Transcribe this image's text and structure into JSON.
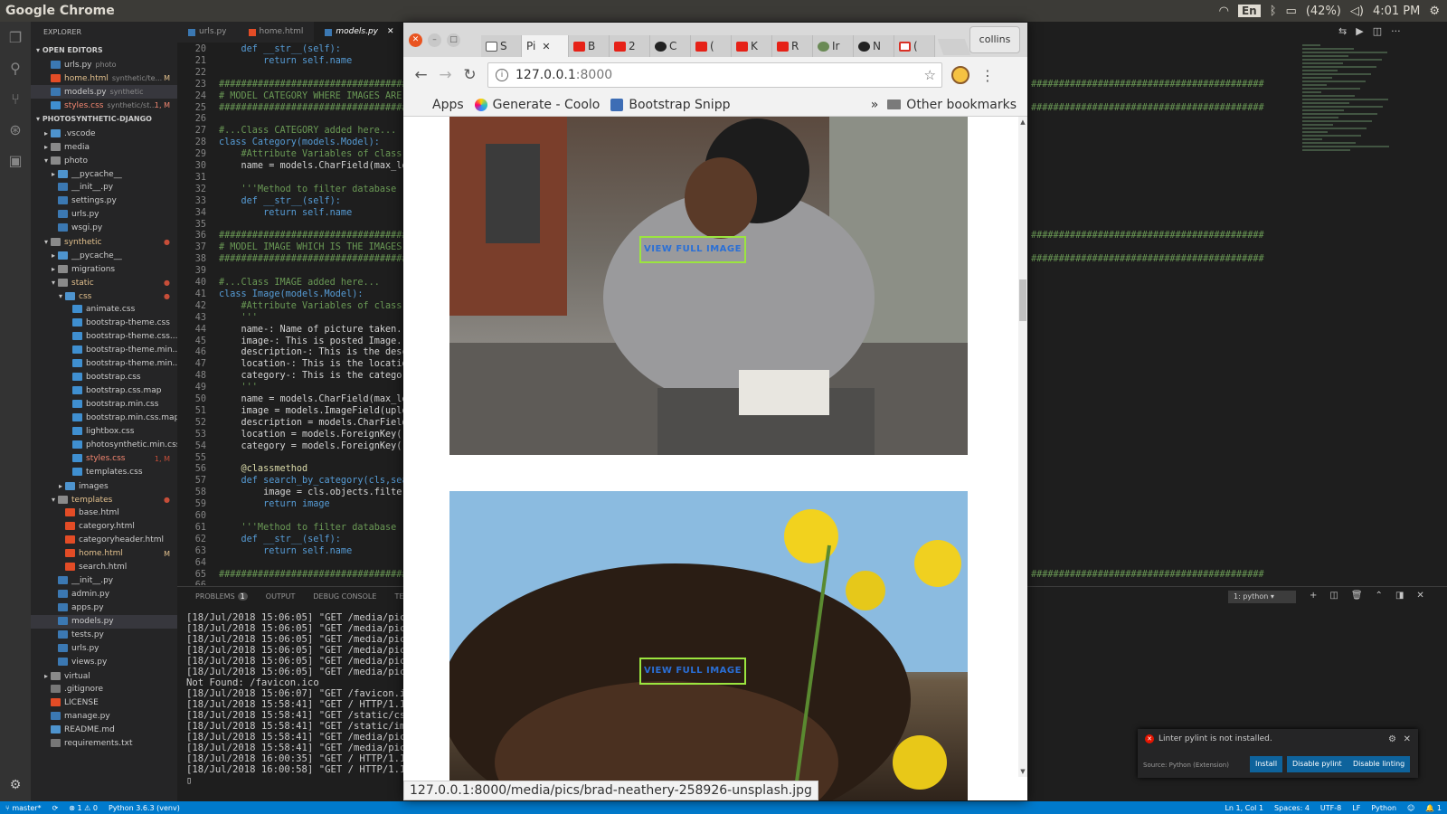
{
  "topbar": {
    "app_name": "Google Chrome",
    "lang": "En",
    "battery": "(42%)",
    "time": "4:01 PM"
  },
  "vscode": {
    "explorer_title": "EXPLORER",
    "open_editors_title": "OPEN EDITORS",
    "open_editors": [
      {
        "name": "urls.py",
        "sub": "photo",
        "badge": "",
        "type": "py"
      },
      {
        "name": "home.html",
        "sub": "synthetic/te...",
        "badge": "M",
        "type": "html"
      },
      {
        "name": "models.py",
        "sub": "synthetic",
        "badge": "",
        "type": "py"
      },
      {
        "name": "styles.css",
        "sub": "synthetic/st...",
        "badge": "1, M",
        "type": "css"
      }
    ],
    "project_title": "PHOTOSYNTHETIC-DJANGO",
    "tree": [
      {
        "name": ".vscode",
        "indent": 1,
        "type": "dirblue",
        "glyph": "▸",
        "badge": ""
      },
      {
        "name": "media",
        "indent": 1,
        "type": "dir",
        "glyph": "▸",
        "badge": ""
      },
      {
        "name": "photo",
        "indent": 1,
        "type": "dir",
        "glyph": "▾",
        "badge": ""
      },
      {
        "name": "__pycache__",
        "indent": 2,
        "type": "dirblue",
        "glyph": "▸",
        "badge": ""
      },
      {
        "name": "__init__.py",
        "indent": 2,
        "type": "py",
        "glyph": "",
        "badge": ""
      },
      {
        "name": "settings.py",
        "indent": 2,
        "type": "py",
        "glyph": "",
        "badge": ""
      },
      {
        "name": "urls.py",
        "indent": 2,
        "type": "py",
        "glyph": "",
        "badge": ""
      },
      {
        "name": "wsgi.py",
        "indent": 2,
        "type": "py",
        "glyph": "",
        "badge": ""
      },
      {
        "name": "synthetic",
        "indent": 1,
        "type": "dir",
        "glyph": "▾",
        "badge": "●"
      },
      {
        "name": "__pycache__",
        "indent": 2,
        "type": "dirblue",
        "glyph": "▸",
        "badge": ""
      },
      {
        "name": "migrations",
        "indent": 2,
        "type": "dir",
        "glyph": "▸",
        "badge": ""
      },
      {
        "name": "static",
        "indent": 2,
        "type": "dir",
        "glyph": "▾",
        "badge": "●"
      },
      {
        "name": "css",
        "indent": 3,
        "type": "dirblue",
        "glyph": "▾",
        "badge": "●"
      },
      {
        "name": "animate.css",
        "indent": 4,
        "type": "css",
        "glyph": "",
        "badge": ""
      },
      {
        "name": "bootstrap-theme.css",
        "indent": 4,
        "type": "css",
        "glyph": "",
        "badge": ""
      },
      {
        "name": "bootstrap-theme.css....",
        "indent": 4,
        "type": "css",
        "glyph": "",
        "badge": ""
      },
      {
        "name": "bootstrap-theme.min....",
        "indent": 4,
        "type": "css",
        "glyph": "",
        "badge": ""
      },
      {
        "name": "bootstrap-theme.min....",
        "indent": 4,
        "type": "css",
        "glyph": "",
        "badge": ""
      },
      {
        "name": "bootstrap.css",
        "indent": 4,
        "type": "css",
        "glyph": "",
        "badge": ""
      },
      {
        "name": "bootstrap.css.map",
        "indent": 4,
        "type": "css",
        "glyph": "",
        "badge": ""
      },
      {
        "name": "bootstrap.min.css",
        "indent": 4,
        "type": "css",
        "glyph": "",
        "badge": ""
      },
      {
        "name": "bootstrap.min.css.map",
        "indent": 4,
        "type": "css",
        "glyph": "",
        "badge": ""
      },
      {
        "name": "lightbox.css",
        "indent": 4,
        "type": "css",
        "glyph": "",
        "badge": ""
      },
      {
        "name": "photosynthetic.min.css",
        "indent": 4,
        "type": "css",
        "glyph": "",
        "badge": ""
      },
      {
        "name": "styles.css",
        "indent": 4,
        "type": "css",
        "glyph": "",
        "badge": "1, M"
      },
      {
        "name": "templates.css",
        "indent": 4,
        "type": "css",
        "glyph": "",
        "badge": ""
      },
      {
        "name": "images",
        "indent": 3,
        "type": "dirblue",
        "glyph": "▸",
        "badge": ""
      },
      {
        "name": "templates",
        "indent": 2,
        "type": "dir",
        "glyph": "▾",
        "badge": "●"
      },
      {
        "name": "base.html",
        "indent": 3,
        "type": "html",
        "glyph": "",
        "badge": ""
      },
      {
        "name": "category.html",
        "indent": 3,
        "type": "html",
        "glyph": "",
        "badge": ""
      },
      {
        "name": "categoryheader.html",
        "indent": 3,
        "type": "html",
        "glyph": "",
        "badge": ""
      },
      {
        "name": "home.html",
        "indent": 3,
        "type": "html",
        "glyph": "",
        "badge": "M"
      },
      {
        "name": "search.html",
        "indent": 3,
        "type": "html",
        "glyph": "",
        "badge": ""
      },
      {
        "name": "__init__.py",
        "indent": 2,
        "type": "py",
        "glyph": "",
        "badge": ""
      },
      {
        "name": "admin.py",
        "indent": 2,
        "type": "py",
        "glyph": "",
        "badge": ""
      },
      {
        "name": "apps.py",
        "indent": 2,
        "type": "py",
        "glyph": "",
        "badge": ""
      },
      {
        "name": "models.py",
        "indent": 2,
        "type": "py",
        "glyph": "",
        "badge": ""
      },
      {
        "name": "tests.py",
        "indent": 2,
        "type": "py",
        "glyph": "",
        "badge": ""
      },
      {
        "name": "urls.py",
        "indent": 2,
        "type": "py",
        "glyph": "",
        "badge": ""
      },
      {
        "name": "views.py",
        "indent": 2,
        "type": "py",
        "glyph": "",
        "badge": ""
      },
      {
        "name": "virtual",
        "indent": 1,
        "type": "dir",
        "glyph": "▸",
        "badge": ""
      },
      {
        "name": ".gitignore",
        "indent": 1,
        "type": "other",
        "glyph": "",
        "badge": ""
      },
      {
        "name": "LICENSE",
        "indent": 1,
        "type": "html",
        "glyph": "",
        "badge": ""
      },
      {
        "name": "manage.py",
        "indent": 1,
        "type": "py",
        "glyph": "",
        "badge": ""
      },
      {
        "name": "README.md",
        "indent": 1,
        "type": "dirblue",
        "glyph": "",
        "badge": ""
      },
      {
        "name": "requirements.txt",
        "indent": 1,
        "type": "other",
        "glyph": "",
        "badge": ""
      }
    ],
    "tabs": [
      {
        "name": "urls.py",
        "active": false
      },
      {
        "name": "home.html",
        "active": false
      },
      {
        "name": "models.py",
        "active": true
      }
    ],
    "code_lines": [
      {
        "n": "20",
        "t": "    def __str__(self):"
      },
      {
        "n": "21",
        "t": "        return self.name"
      },
      {
        "n": "22",
        "t": ""
      },
      {
        "n": "23",
        "t": "############################################"
      },
      {
        "n": "24",
        "t": "# MODEL CATEGORY WHERE IMAGES ARE C"
      },
      {
        "n": "25",
        "t": "############################################"
      },
      {
        "n": "26",
        "t": ""
      },
      {
        "n": "27",
        "t": "#...Class CATEGORY added here..."
      },
      {
        "n": "28",
        "t": "class Category(models.Model):"
      },
      {
        "n": "29",
        "t": "    #Attribute Variables of class C"
      },
      {
        "n": "30",
        "t": "    name = models.CharField(max_len"
      },
      {
        "n": "31",
        "t": ""
      },
      {
        "n": "32",
        "t": "    '''Method to filter database re"
      },
      {
        "n": "33",
        "t": "    def __str__(self):"
      },
      {
        "n": "34",
        "t": "        return self.name"
      },
      {
        "n": "35",
        "t": ""
      },
      {
        "n": "36",
        "t": "############################################"
      },
      {
        "n": "37",
        "t": "# MODEL IMAGE WHICH IS THE IMAGES O"
      },
      {
        "n": "38",
        "t": "############################################"
      },
      {
        "n": "39",
        "t": ""
      },
      {
        "n": "40",
        "t": "#...Class IMAGE added here..."
      },
      {
        "n": "41",
        "t": "class Image(models.Model):"
      },
      {
        "n": "42",
        "t": "    #Attribute Variables of class I"
      },
      {
        "n": "43",
        "t": "    '''"
      },
      {
        "n": "44",
        "t": "    name-: Name of picture taken."
      },
      {
        "n": "45",
        "t": "    image-: This is posted Image."
      },
      {
        "n": "46",
        "t": "    description-: This is the desc"
      },
      {
        "n": "47",
        "t": "    location-: This is the location"
      },
      {
        "n": "48",
        "t": "    category-: This is the category"
      },
      {
        "n": "49",
        "t": "    '''"
      },
      {
        "n": "50",
        "t": "    name = models.CharField(max_len"
      },
      {
        "n": "51",
        "t": "    image = models.ImageField(uploa"
      },
      {
        "n": "52",
        "t": "    description = models.CharField"
      },
      {
        "n": "53",
        "t": "    location = models.ForeignKey('"
      },
      {
        "n": "54",
        "t": "    category = models.ForeignKey('C"
      },
      {
        "n": "55",
        "t": ""
      },
      {
        "n": "56",
        "t": "    @classmethod"
      },
      {
        "n": "57",
        "t": "    def search_by_category(cls,sear"
      },
      {
        "n": "58",
        "t": "        image = cls.objects.filter"
      },
      {
        "n": "59",
        "t": "        return image"
      },
      {
        "n": "60",
        "t": ""
      },
      {
        "n": "61",
        "t": "    '''Method to filter database re"
      },
      {
        "n": "62",
        "t": "    def __str__(self):"
      },
      {
        "n": "63",
        "t": "        return self.name"
      },
      {
        "n": "64",
        "t": ""
      },
      {
        "n": "65",
        "t": "############################################"
      },
      {
        "n": "66",
        "t": ""
      }
    ],
    "code_right_lines": [
      {
        "t": "",
        "y": 0
      },
      {
        "t": "##########################################",
        "y": 3
      },
      {
        "t": "##########################################",
        "y": 5
      },
      {
        "t": "##########################################",
        "y": 16
      },
      {
        "t": "##########################################",
        "y": 18
      },
      {
        "t": "##########################################",
        "y": 45
      }
    ],
    "panel_tabs": [
      "PROBLEMS",
      "OUTPUT",
      "DEBUG CONSOLE",
      "TE"
    ],
    "problems_count": "1",
    "terminal_select": "1: python",
    "terminal_lines": [
      "[18/Jul/2018 15:06:05] \"GET /media/pics/",
      "[18/Jul/2018 15:06:05] \"GET /media/pics/",
      "[18/Jul/2018 15:06:05] \"GET /media/pics/",
      "[18/Jul/2018 15:06:05] \"GET /media/pics/",
      "[18/Jul/2018 15:06:05] \"GET /media/pics/",
      "[18/Jul/2018 15:06:05] \"GET /media/pics/",
      "Not Found: /favicon.ico",
      "[18/Jul/2018 15:06:07] \"GET /favicon.ico",
      "[18/Jul/2018 15:58:41] \"GET / HTTP/1.1\"",
      "[18/Jul/2018 15:58:41] \"GET /static/css/",
      "[18/Jul/2018 15:58:41] \"GET /static/imag",
      "[18/Jul/2018 15:58:41] \"GET /media/pics/",
      "[18/Jul/2018 15:58:41] \"GET /media/pics/",
      "[18/Jul/2018 16:00:35] \"GET / HTTP/1.1\"",
      "[18/Jul/2018 16:00:58] \"GET / HTTP/1.1\"",
      "▯"
    ],
    "notification": {
      "message": "Linter pylint is not installed.",
      "source": "Source: Python (Extension)",
      "install": "Install",
      "disable_pylint": "Disable pylint",
      "disable_linting": "Disable linting"
    },
    "status": {
      "branch": "master*",
      "errors": "1",
      "warnings": "0",
      "interpreter": "Python 3.6.3 (venv)",
      "position": "Ln 1, Col 1",
      "spaces": "Spaces: 4",
      "encoding": "UTF-8",
      "eol": "LF",
      "language": "Python",
      "bell": "1"
    }
  },
  "chrome": {
    "tabs": [
      {
        "label": "S",
        "fav": "doc",
        "active": false
      },
      {
        "label": "Pi",
        "fav": "",
        "active": true
      },
      {
        "label": "B",
        "fav": "yt",
        "active": false
      },
      {
        "label": "2",
        "fav": "yt",
        "active": false
      },
      {
        "label": "C",
        "fav": "gh",
        "active": false
      },
      {
        "label": "(",
        "fav": "yt",
        "active": false
      },
      {
        "label": "K",
        "fav": "yt",
        "active": false
      },
      {
        "label": "R",
        "fav": "yt",
        "active": false
      },
      {
        "label": "Ir",
        "fav": "tree",
        "active": false
      },
      {
        "label": "N",
        "fav": "gh",
        "active": false
      },
      {
        "label": "(",
        "fav": "gm",
        "active": false
      }
    ],
    "profile": "collins",
    "url_host": "127.0.0.1",
    "url_port": ":8000",
    "bookmarks": {
      "apps": "Apps",
      "item1": "Generate - Coolo",
      "item2": "Bootstrap Snipp",
      "more": "»",
      "other": "Other bookmarks"
    },
    "page": {
      "view_full_image_1": "VIEW FULL IMAGE",
      "view_full_image_2": "VIEW FULL IMAGE"
    },
    "status_url": "127.0.0.1:8000/media/pics/brad-neathery-258926-unsplash.jpg"
  }
}
